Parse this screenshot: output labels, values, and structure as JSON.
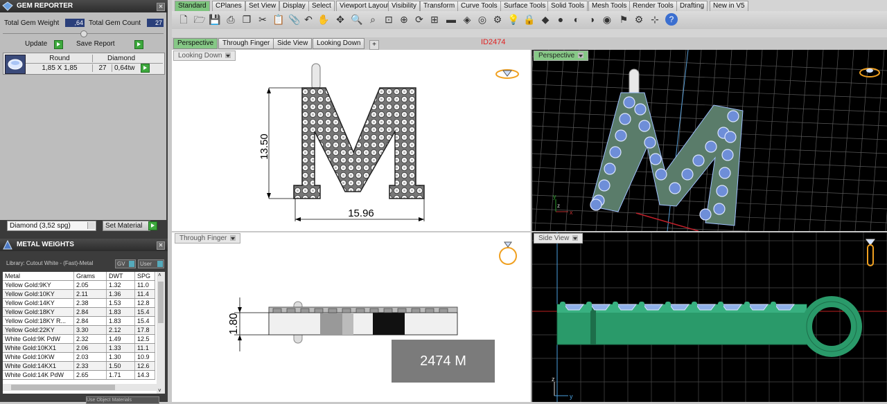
{
  "gem_reporter": {
    "title": "GEM REPORTER",
    "total_gem_weight_label": "Total Gem Weight",
    "total_gem_weight_value": ",64",
    "total_gem_count_label": "Total Gem Count",
    "total_gem_count_value": "27",
    "update_label": "Update",
    "save_report_label": "Save Report",
    "grid_headers": [
      "Round",
      "Diamond"
    ],
    "row": {
      "size": "1,85 X 1,85",
      "count": "27",
      "weight": "0,64tw"
    },
    "material_select": "Diamond   (3,52 spg)",
    "set_material_label": "Set Material"
  },
  "metal_weights": {
    "title": "METAL WEIGHTS",
    "library": "Library: Cutout White - (Fast)-Metal",
    "btn_gv": "GV",
    "btn_user": "User",
    "columns": [
      "Metal",
      "Grams",
      "DWT",
      "SPG"
    ],
    "rows": [
      [
        "Yellow Gold:9KY",
        "2.05",
        "1.32",
        "11.0"
      ],
      [
        "Yellow Gold:10KY",
        "2.11",
        "1.36",
        "11.4"
      ],
      [
        "Yellow Gold:14KY",
        "2.38",
        "1.53",
        "12.8"
      ],
      [
        "Yellow Gold:18KY",
        "2.84",
        "1.83",
        "15.4"
      ],
      [
        "Yellow Gold:18KY R...",
        "2.84",
        "1.83",
        "15.4"
      ],
      [
        "Yellow Gold:22KY",
        "3.30",
        "2.12",
        "17.8"
      ],
      [
        "White Gold:9K PdW",
        "2.32",
        "1.49",
        "12.5"
      ],
      [
        "White Gold:10KX1",
        "2.06",
        "1.33",
        "11.1"
      ],
      [
        "White Gold:10KW",
        "2.03",
        "1.30",
        "10.9"
      ],
      [
        "White Gold:14KX1",
        "2.33",
        "1.50",
        "12.6"
      ],
      [
        "White Gold:14K PdW",
        "2.65",
        "1.71",
        "14.3"
      ]
    ],
    "footer_btn": "Use Object Materials"
  },
  "toolbar_tabs": [
    "Standard",
    "CPlanes",
    "Set View",
    "Display",
    "Select",
    "Viewport Layout",
    "Visibility",
    "Transform",
    "Curve Tools",
    "Surface Tools",
    "Solid Tools",
    "Mesh Tools",
    "Render Tools",
    "Drafting",
    "New in V5"
  ],
  "view_tabs": [
    "Perspective",
    "Through Finger",
    "Side View",
    "Looking Down"
  ],
  "model_id": "ID2474",
  "viewports": {
    "top_left": {
      "label": "Looking Down",
      "dim_height": "13.50",
      "dim_width": "15.96",
      "letter": "M"
    },
    "top_right": {
      "label": "Perspective",
      "letter": "M"
    },
    "bottom_left": {
      "label": "Through Finger",
      "dim_thickness": "1.80",
      "stamp": "2474 M"
    },
    "bottom_right": {
      "label": "Side View"
    }
  },
  "colors": {
    "accent_green": "#7ec47e",
    "metal_green": "#2a9a6a",
    "gem_blue": "#8fb0e8",
    "id_red": "#e02020"
  }
}
